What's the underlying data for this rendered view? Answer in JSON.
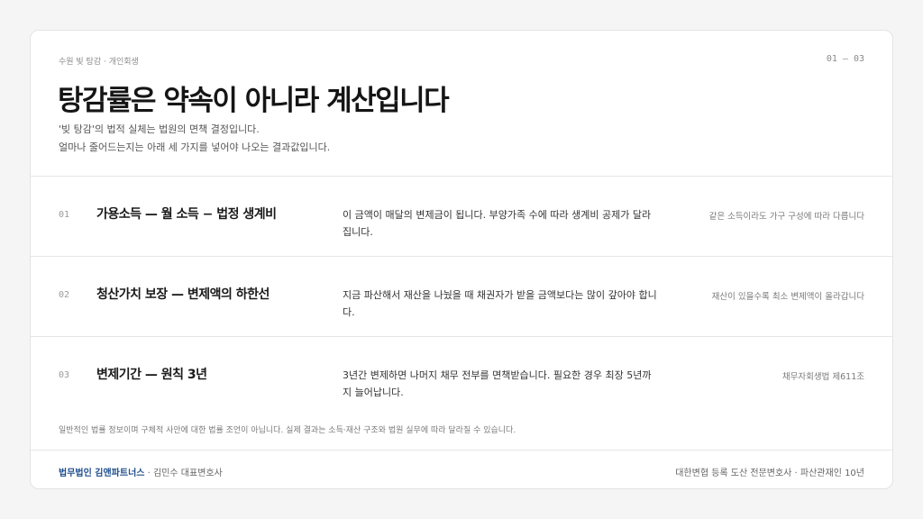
{
  "header": {
    "eyebrow": "수원 빚 탕감 · 개인회생",
    "pager": "01 — 03",
    "title": "탕감률은 약속이 아니라 계산입니다",
    "desc_line1": "'빚 탕감'의 법적 실체는 법원의 면책 결정입니다.",
    "desc_line2": "얼마나 줄어드는지는 아래 세 가지를 넣어야 나오는 결과값입니다."
  },
  "rows": [
    {
      "num": "01",
      "title": "가용소득 — 월 소득 − 법정 생계비",
      "body": "이 금액이 매달의 변제금이 됩니다. 부양가족 수에 따라 생계비 공제가 달라집니다.",
      "note": "같은 소득이라도 가구 구성에 따라 다릅니다"
    },
    {
      "num": "02",
      "title": "청산가치 보장 — 변제액의 하한선",
      "body": "지금 파산해서 재산을 나눴을 때 채권자가 받을 금액보다는 많이 갚아야 합니다.",
      "note": "재산이 있을수록 최소 변제액이 올라갑니다"
    },
    {
      "num": "03",
      "title": "변제기간 — 원칙 3년",
      "body": "3년간 변제하면 나머지 채무 전부를 면책받습니다. 필요한 경우 최장 5년까지 늘어납니다.",
      "note": "채무자회생법 제611조"
    }
  ],
  "disclaimer": "일반적인 법률 정보이며 구체적 사안에 대한 법률 조언이 아닙니다. 실제 결과는 소득·재산 구조와 법원 실무에 따라 달라질 수 있습니다.",
  "footer": {
    "firm_name": "법무법인 김앤파트너스",
    "firm_rest": " · 김민수 대표변호사",
    "credentials": "대한변협 등록 도산 전문변호사 · 파산관재인 10년"
  },
  "colors": {
    "accent": "#1f4e8c",
    "background": "#f5f5f5",
    "card": "#ffffff"
  }
}
